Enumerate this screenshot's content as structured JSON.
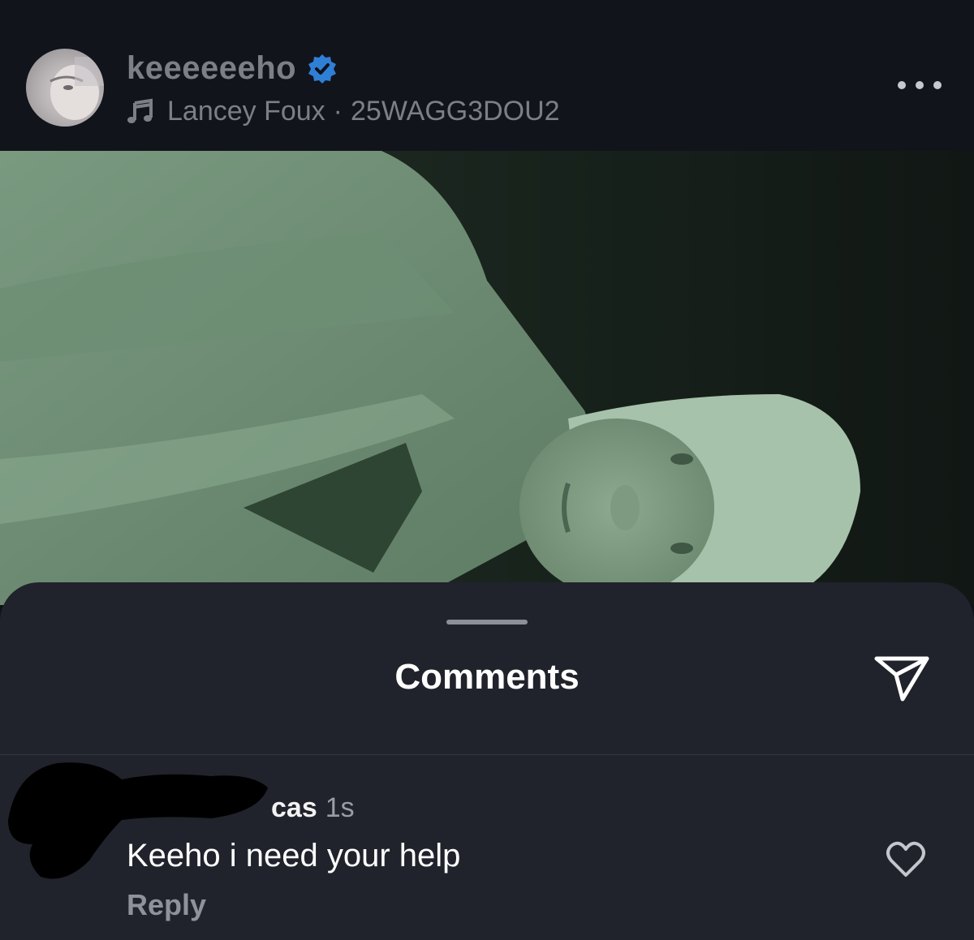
{
  "post": {
    "username": "keeeeeeho",
    "verified": true,
    "music_artist": "Lancey Foux",
    "separator": "·",
    "music_track": "25WAGG3DOU2",
    "icons": {
      "music": "music-note-icon",
      "verified": "verified-badge-icon",
      "more": "more-icon"
    }
  },
  "comments_sheet": {
    "title": "Comments",
    "share_icon": "send-icon",
    "comments": [
      {
        "username_visible": "cas",
        "time": "1s",
        "text": "Keeho i need your help",
        "reply_label": "Reply",
        "like_icon": "heart-icon"
      }
    ]
  },
  "colors": {
    "background": "#0f1217",
    "sheet": "#20232b",
    "muted_text": "#7b7f88",
    "verified_blue": "#2f7fd6",
    "photo_tint": "#6f8f74"
  }
}
